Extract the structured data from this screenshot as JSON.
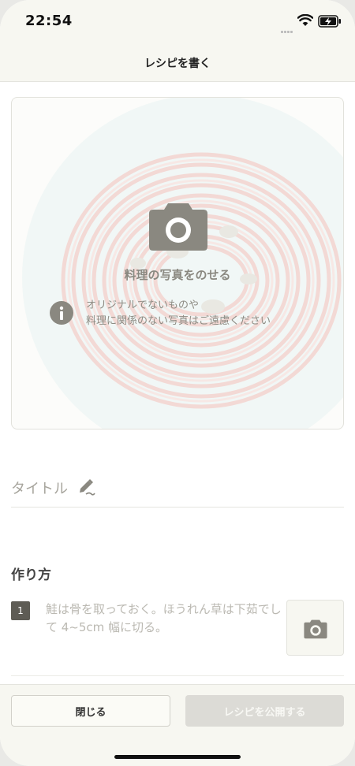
{
  "status_bar": {
    "time": "22:54",
    "icons": [
      "signal-dots-icon",
      "wifi-icon",
      "battery-charging-icon"
    ]
  },
  "nav": {
    "title": "レシピを書く"
  },
  "photo_upload": {
    "label": "料理の写真をのせる",
    "notice": "オリジナルでないものや\n料理に関係のない写真はご遠慮ください",
    "icons": [
      "camera-icon",
      "info-icon"
    ]
  },
  "title_field": {
    "placeholder": "タイトル",
    "icon": "pencil-icon"
  },
  "steps": {
    "heading": "作り方",
    "items": [
      {
        "number": "1",
        "placeholder": "鮭は骨を取っておく。ほうれん草は下茹でして 4~5cm 幅に切る。",
        "icon": "camera-icon"
      }
    ]
  },
  "footer": {
    "close_label": "閉じる",
    "publish_label": "レシピを公開する"
  },
  "colors": {
    "accent_gray": "#8a8880",
    "step_badge": "#5e5c55",
    "disabled_button": "#dcdbd6",
    "bar_background": "#f7f7f1"
  }
}
